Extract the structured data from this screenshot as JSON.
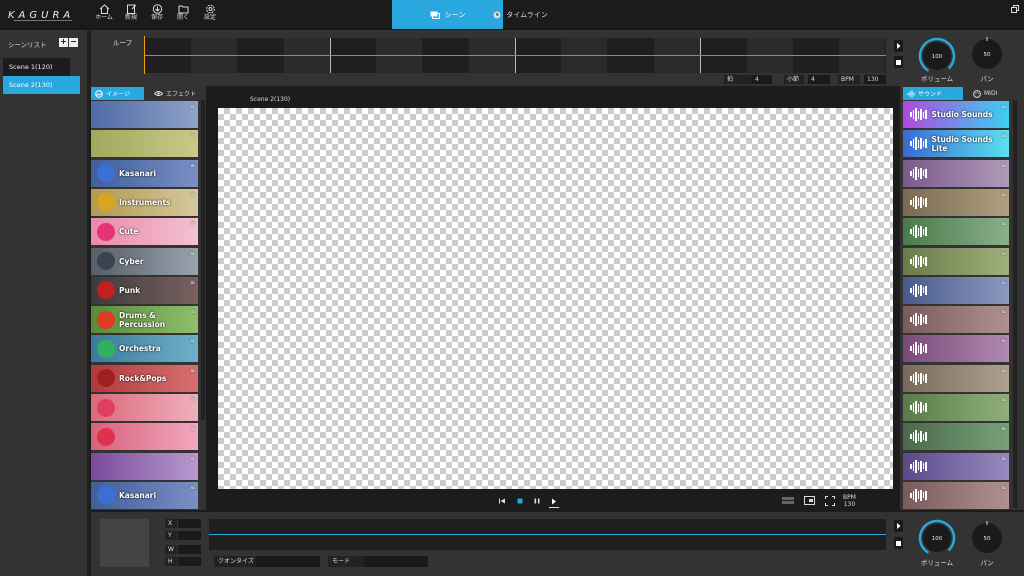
{
  "topbar": {
    "logo_text": "KAGURA",
    "buttons": [
      {
        "label": "ホーム",
        "icon": "home-icon"
      },
      {
        "label": "新規",
        "icon": "new-icon"
      },
      {
        "label": "保存",
        "icon": "save-icon"
      },
      {
        "label": "開く",
        "icon": "open-icon"
      },
      {
        "label": "設定",
        "icon": "settings-icon"
      }
    ],
    "tabs": [
      {
        "label": "シーン",
        "icon": "scene-icon",
        "active": true
      },
      {
        "label": "タイムライン",
        "icon": "clock-icon",
        "active": false
      }
    ],
    "accent": "#29a8e0"
  },
  "scenelist": {
    "title": "シーンリスト",
    "add": "+",
    "remove": "−",
    "items": [
      {
        "label": "Scene 1(120)",
        "selected": false
      },
      {
        "label": "Scene 2(130)",
        "selected": true
      }
    ]
  },
  "loop": {
    "label": "ループ",
    "beat_label": "拍",
    "beat_value": "4",
    "measure_label": "小節",
    "measure_value": "4",
    "bpm_label": "BPM",
    "bpm_value": "130"
  },
  "master": {
    "volume_value": "100",
    "volume_label": "ボリューム",
    "pan_value": "50",
    "pan_label": "パン"
  },
  "left_panel": {
    "tabs": [
      {
        "label": "イメージ",
        "icon": "image-icon",
        "active": true
      },
      {
        "label": "エフェクト",
        "icon": "eye-icon",
        "active": false
      }
    ],
    "categories": [
      {
        "label": "",
        "bg": "linear-gradient(90deg,#4f6aa8,#8fa3c7)"
      },
      {
        "label": "",
        "bg": "linear-gradient(90deg,#a2a85a,#c9c98a)"
      },
      {
        "label": "Kasanari",
        "bg": "linear-gradient(90deg,#3f5f9a,#7b8fc4)",
        "ic": "#3b6fd6"
      },
      {
        "label": "Instruments",
        "bg": "linear-gradient(90deg,#b09a50,#d6c89a)",
        "ic": "#d9a520"
      },
      {
        "label": "Cute",
        "bg": "linear-gradient(90deg,#e88aa8,#f5c2d2)",
        "ic": "#e8327a"
      },
      {
        "label": "Cyber",
        "bg": "linear-gradient(90deg,#565e68,#9aa3ad)",
        "ic": "#3a444e"
      },
      {
        "label": "Punk",
        "bg": "linear-gradient(90deg,#3c3c3c,#7a6060)",
        "ic": "#c02020"
      },
      {
        "label": "Drums & Percussion",
        "bg": "linear-gradient(90deg,#5a8a3a,#8ec06a)",
        "ic": "#e03a20"
      },
      {
        "label": "Orchestra",
        "bg": "linear-gradient(90deg,#3a7a9a,#70b0c8)",
        "ic": "#30b060"
      },
      {
        "label": "Rock&Pops",
        "bg": "linear-gradient(90deg,#b03a3a,#d87070)",
        "ic": "#a02020"
      },
      {
        "label": "",
        "bg": "linear-gradient(90deg,#d86a7a,#f0b0bd)",
        "ic": "#e04060"
      },
      {
        "label": "",
        "bg": "linear-gradient(90deg,#d8607a,#f2a8c0)",
        "ic": "#e03050"
      },
      {
        "label": "",
        "bg": "linear-gradient(90deg,#7a4a9a,#b89ad0)"
      },
      {
        "label": "Kasanari",
        "bg": "linear-gradient(90deg,#3f5f9a,#7b8fc4)",
        "ic": "#3b6fd6"
      }
    ]
  },
  "canvas": {
    "scene_name": "Scene 2(130)"
  },
  "transport": {
    "bpm_label": "BPM",
    "bpm_value": "130"
  },
  "right_panel": {
    "tabs": [
      {
        "label": "サウンド",
        "icon": "sound-icon",
        "active": true
      },
      {
        "label": "MIDI",
        "icon": "midi-icon",
        "active": false
      }
    ],
    "sounds": [
      {
        "label": "Studio Sounds",
        "bg": "linear-gradient(90deg,#b04ae0,#3ad0f0)"
      },
      {
        "label": "Studio Sounds Lite",
        "bg": "linear-gradient(90deg,#3a6ad0,#5ae0f0)"
      },
      {
        "label": "",
        "bg": "linear-gradient(90deg,#7a5a8a,#b09ab8)"
      },
      {
        "label": "",
        "bg": "linear-gradient(90deg,#7a6a50,#b0a080)"
      },
      {
        "label": "",
        "bg": "linear-gradient(90deg,#4a7a4a,#8ab08a)"
      },
      {
        "label": "",
        "bg": "linear-gradient(90deg,#6a7a4a,#a0b07a)"
      },
      {
        "label": "",
        "bg": "linear-gradient(90deg,#4a5a8a,#8a9ac0)"
      },
      {
        "label": "",
        "bg": "linear-gradient(90deg,#7a5a5a,#b09090)"
      },
      {
        "label": "",
        "bg": "linear-gradient(90deg,#7a4a7a,#b08ab0)"
      },
      {
        "label": "",
        "bg": "linear-gradient(90deg,#7a6a5a,#b0a090)"
      },
      {
        "label": "",
        "bg": "linear-gradient(90deg,#5a7a4a,#90b07a)"
      },
      {
        "label": "",
        "bg": "linear-gradient(90deg,#4a6a4a,#7aa07a)"
      },
      {
        "label": "",
        "bg": "linear-gradient(90deg,#5a4a8a,#9a8ac0)"
      },
      {
        "label": "",
        "bg": "linear-gradient(90deg,#7a5a5a,#b09090)"
      }
    ]
  },
  "bottom": {
    "x_label": "X",
    "y_label": "Y",
    "w_label": "W",
    "h_label": "H",
    "quantize_label": "クオンタイズ",
    "mode_label": "モード",
    "volume_value": "100",
    "volume_label": "ボリューム",
    "pan_value": "50",
    "pan_label": "パン"
  }
}
